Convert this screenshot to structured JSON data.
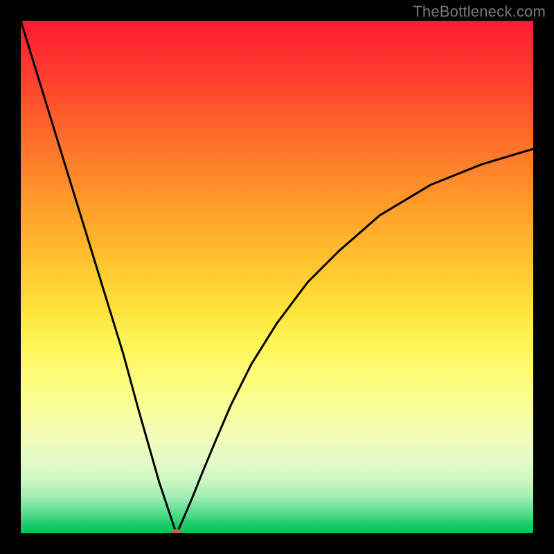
{
  "watermark": {
    "text": "TheBottleneck.com"
  },
  "chart_data": {
    "type": "line",
    "title": "",
    "xlabel": "",
    "ylabel": "",
    "xlim": [
      0,
      100
    ],
    "ylim": [
      0,
      100
    ],
    "grid": false,
    "legend": false,
    "annotations": [
      {
        "type": "marker",
        "x": 30.4,
        "y": 0,
        "color": "#b9624f",
        "shape": "rounded-rect"
      }
    ],
    "series": [
      {
        "name": "bottleneck-curve",
        "color": "#000000",
        "x": [
          0,
          4,
          8,
          12,
          16,
          20,
          23,
          25,
          27,
          28.5,
          29.5,
          30.0,
          30.4,
          31.0,
          32.0,
          33.5,
          35.5,
          38,
          41,
          45,
          50,
          56,
          62,
          70,
          80,
          90,
          100
        ],
        "values": [
          100,
          87,
          74,
          61,
          48,
          35,
          24,
          17,
          10,
          5.5,
          2.5,
          1.0,
          0.0,
          1.2,
          3.5,
          7.0,
          12,
          18,
          25,
          33,
          41,
          49,
          55,
          62,
          68,
          72,
          75
        ]
      }
    ],
    "background": {
      "type": "vertical-gradient",
      "stops": [
        {
          "pos": 0.0,
          "color": "#ff1a32"
        },
        {
          "pos": 0.22,
          "color": "#ff6a2a"
        },
        {
          "pos": 0.46,
          "color": "#ffbf2e"
        },
        {
          "pos": 0.7,
          "color": "#fdfd7c"
        },
        {
          "pos": 0.9,
          "color": "#c8f6c0"
        },
        {
          "pos": 1.0,
          "color": "#00c354"
        }
      ]
    }
  }
}
